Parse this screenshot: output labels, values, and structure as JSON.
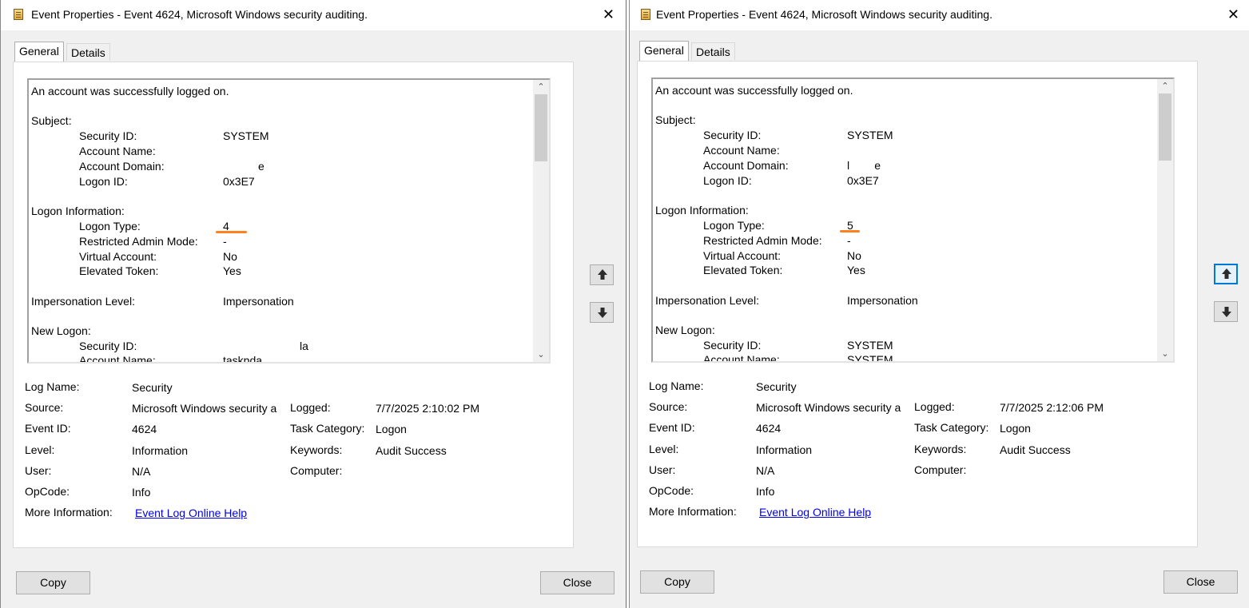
{
  "windows": [
    {
      "title": "Event Properties - Event 4624, Microsoft Windows security auditing.",
      "close_glyph": "✕",
      "tabs": [
        "General",
        "Details"
      ],
      "message": {
        "lines": [
          {
            "label": "An account was successfully logged on.",
            "value": ""
          },
          {
            "label": "Subject:",
            "value": ""
          },
          {
            "label": "Security ID:",
            "value": "SYSTEM"
          },
          {
            "label": "Account Name:",
            "value": ""
          },
          {
            "label": "Account Domain:",
            "value": "e"
          },
          {
            "label": "Logon ID:",
            "value": "0x3E7"
          },
          {
            "label": "Logon Information:",
            "value": ""
          },
          {
            "label": "Logon Type:",
            "value": "4"
          },
          {
            "label": "Restricted Admin Mode:",
            "value": "-"
          },
          {
            "label": "Virtual Account:",
            "value": "No"
          },
          {
            "label": "Elevated Token:",
            "value": "Yes"
          },
          {
            "label": "Impersonation Level:",
            "value": "Impersonation"
          },
          {
            "label": "New Logon:",
            "value": ""
          },
          {
            "label": "Security ID:",
            "value": "la"
          },
          {
            "label": "Account Name:",
            "value": "taskpda"
          }
        ]
      },
      "fields": {
        "log_name_label": "Log Name:",
        "log_name": "Security",
        "source_label": "Source:",
        "source": "Microsoft Windows security a",
        "logged_label": "Logged:",
        "logged": "7/7/2025 2:10:02 PM",
        "event_id_label": "Event ID:",
        "event_id": "4624",
        "task_category_label": "Task Category:",
        "task_category": "Logon",
        "level_label": "Level:",
        "level": "Information",
        "keywords_label": "Keywords:",
        "keywords": "Audit Success",
        "user_label": "User:",
        "user": "N/A",
        "computer_label": "Computer:",
        "computer": "",
        "opcode_label": "OpCode:",
        "opcode": "Info",
        "more_info_label": "More Information:",
        "more_info_link": "Event Log Online Help"
      },
      "buttons": {
        "copy": "Copy",
        "close": "Close"
      }
    },
    {
      "title": "Event Properties - Event 4624, Microsoft Windows security auditing.",
      "close_glyph": "✕",
      "tabs": [
        "General",
        "Details"
      ],
      "message": {
        "lines": [
          {
            "label": "An account was successfully logged on.",
            "value": ""
          },
          {
            "label": "Subject:",
            "value": ""
          },
          {
            "label": "Security ID:",
            "value": "SYSTEM"
          },
          {
            "label": "Account Name:",
            "value": ""
          },
          {
            "label": "Account Domain:",
            "value": "l        e"
          },
          {
            "label": "Logon ID:",
            "value": "0x3E7"
          },
          {
            "label": "Logon Information:",
            "value": ""
          },
          {
            "label": "Logon Type:",
            "value": "5"
          },
          {
            "label": "Restricted Admin Mode:",
            "value": "-"
          },
          {
            "label": "Virtual Account:",
            "value": "No"
          },
          {
            "label": "Elevated Token:",
            "value": "Yes"
          },
          {
            "label": "Impersonation Level:",
            "value": "Impersonation"
          },
          {
            "label": "New Logon:",
            "value": ""
          },
          {
            "label": "Security ID:",
            "value": "SYSTEM"
          },
          {
            "label": "Account Name:",
            "value": "SYSTEM"
          }
        ]
      },
      "fields": {
        "log_name_label": "Log Name:",
        "log_name": "Security",
        "source_label": "Source:",
        "source": "Microsoft Windows security a",
        "logged_label": "Logged:",
        "logged": "7/7/2025 2:12:06 PM",
        "event_id_label": "Event ID:",
        "event_id": "4624",
        "task_category_label": "Task Category:",
        "task_category": "Logon",
        "level_label": "Level:",
        "level": "Information",
        "keywords_label": "Keywords:",
        "keywords": "Audit Success",
        "user_label": "User:",
        "user": "N/A",
        "computer_label": "Computer:",
        "computer": "",
        "opcode_label": "OpCode:",
        "opcode": "Info",
        "more_info_label": "More Information:",
        "more_info_link": "Event Log Online Help"
      },
      "buttons": {
        "copy": "Copy",
        "close": "Close"
      }
    }
  ],
  "colors": {
    "highlight_underline": "#ff8122",
    "link": "#0000ee",
    "focus": "#0078d7"
  },
  "icons": {
    "app": "event-log-icon",
    "up": "arrow-up-icon",
    "down": "arrow-down-icon",
    "close": "close-icon"
  }
}
